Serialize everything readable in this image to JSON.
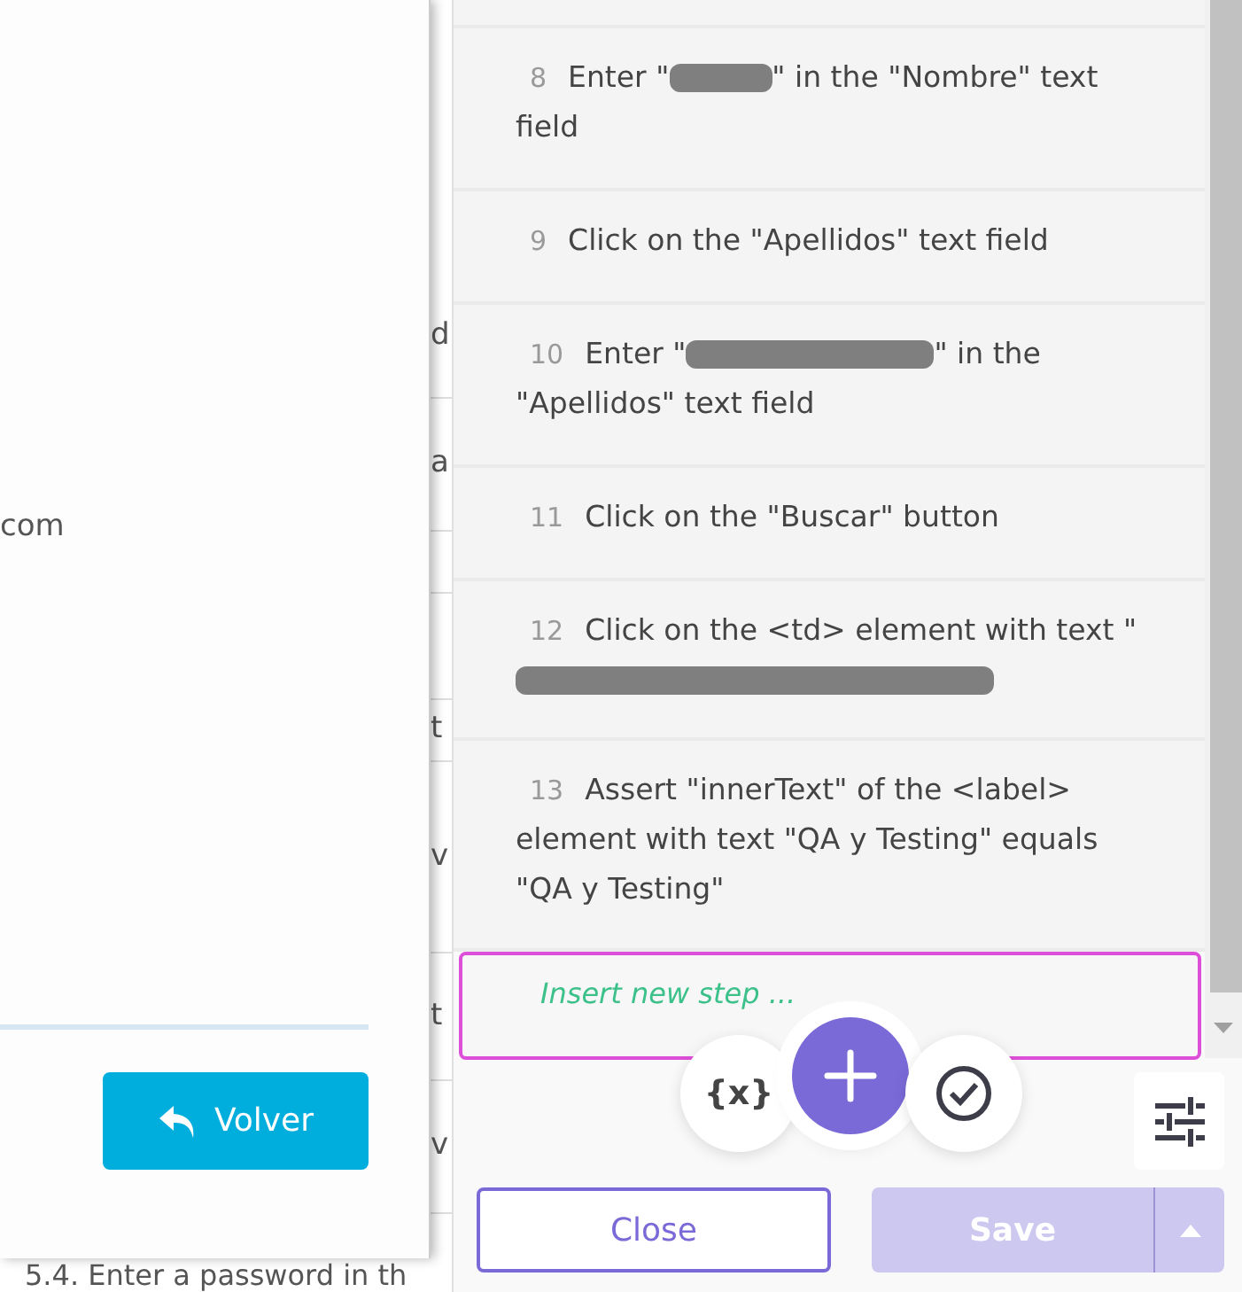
{
  "background_page": {
    "fragments": [
      "d",
      "a",
      "t",
      "v",
      "t",
      "v"
    ],
    "footer_text": "5.4. Enter a password in th"
  },
  "modal": {
    "text": "com",
    "button": "Volver"
  },
  "steps": [
    {
      "number": "8",
      "segments": [
        {
          "kind": "text",
          "text": "Enter \""
        },
        {
          "kind": "redacted"
        },
        {
          "kind": "text",
          "text": "\" in the \"Nombre\" text field"
        }
      ]
    },
    {
      "number": "9",
      "segments": [
        {
          "kind": "text",
          "text": "Click on the \"Apellidos\" text field"
        }
      ]
    },
    {
      "number": "10",
      "segments": [
        {
          "kind": "text",
          "text": "Enter \""
        },
        {
          "kind": "redacted"
        },
        {
          "kind": "text",
          "text": "\" in the \"Apellidos\" text field"
        }
      ]
    },
    {
      "number": "11",
      "segments": [
        {
          "kind": "text",
          "text": "Click on the \"Buscar\" button"
        }
      ]
    },
    {
      "number": "12",
      "segments": [
        {
          "kind": "text",
          "text": "Click on the <td> element with text \""
        },
        {
          "kind": "redacted"
        }
      ]
    },
    {
      "number": "13",
      "segments": [
        {
          "kind": "text",
          "text": "Assert \"innerText\" of the <label> element with text \"QA y Testing\" equals \"QA y Testing\""
        }
      ]
    }
  ],
  "insert_field": {
    "placeholder": "Insert new step ..."
  },
  "actions": {
    "variables_label": "{x}"
  },
  "buttons": {
    "close": "Close",
    "save": {
      "label": "Save",
      "disabled": true
    }
  }
}
